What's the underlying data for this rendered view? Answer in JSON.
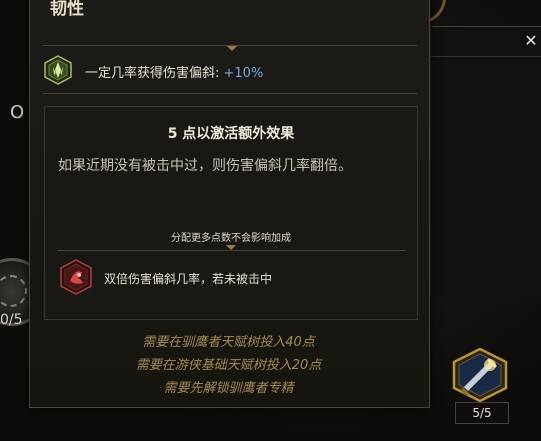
{
  "tooltip": {
    "title": "韧性",
    "stat": {
      "icon": "shield-leaf-icon",
      "label": "一定几率获得伤害偏斜: ",
      "value": "+10%",
      "value_color": "#6fa9e6"
    },
    "bonus_box": {
      "title": "5 点以激活额外效果",
      "description": "如果近期没有被击中过，则伤害偏斜几率翻倍。",
      "note": "分配更多点数不会影响加成",
      "bonus": {
        "icon": "red-rune-icon",
        "label": "双倍伤害偏斜几率，若未被击中"
      }
    },
    "requirements": [
      "需要在驯鹰者天赋树投入40点",
      "需要在游侠基础天赋树投入20点",
      "需要先解锁驯鹰者专精"
    ]
  },
  "background": {
    "left_char": "O",
    "left_node_count": "0/5",
    "right_node": {
      "icon": "sword-strike-icon",
      "count": "5/5"
    },
    "close_icon": "close-icon",
    "close_glyph": "✕"
  },
  "colors": {
    "requirement_text": "#a58a57",
    "accent_gold": "#a07a4a",
    "stat_value_blue": "#6fa9e6"
  }
}
